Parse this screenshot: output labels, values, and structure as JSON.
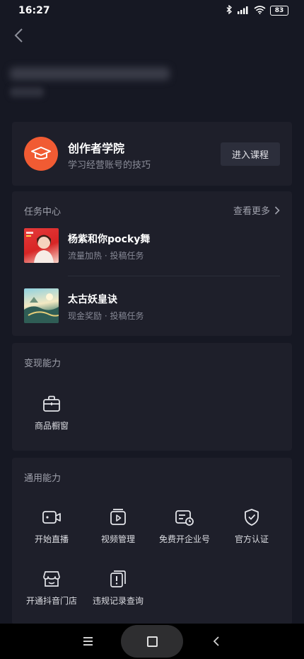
{
  "status_bar": {
    "time": "16:27",
    "battery": "83"
  },
  "academy": {
    "title": "创作者学院",
    "subtitle": "学习经营账号的技巧",
    "enter_label": "进入课程"
  },
  "task_center": {
    "heading": "任务中心",
    "see_more": "查看更多",
    "tasks": [
      {
        "title": "杨紫和你pocky舞",
        "subtitle": "流量加热 · 投稿任务"
      },
      {
        "title": "太古妖皇诀",
        "subtitle": "现金奖励 · 投稿任务"
      }
    ]
  },
  "monetize": {
    "heading": "变现能力",
    "items": [
      {
        "label": "商品橱窗",
        "icon": "shop-window-icon"
      }
    ]
  },
  "general": {
    "heading": "通用能力",
    "items": [
      {
        "label": "开始直播",
        "icon": "live-camera-icon"
      },
      {
        "label": "视频管理",
        "icon": "video-manage-icon"
      },
      {
        "label": "免费开企业号",
        "icon": "enterprise-account-icon"
      },
      {
        "label": "官方认证",
        "icon": "verified-shield-icon"
      },
      {
        "label": "开通抖音门店",
        "icon": "store-icon"
      },
      {
        "label": "违规记录查询",
        "icon": "violation-record-icon"
      }
    ]
  },
  "colors": {
    "background": "#161823",
    "card": "#1e1f2a",
    "accent": "#f15b33"
  }
}
